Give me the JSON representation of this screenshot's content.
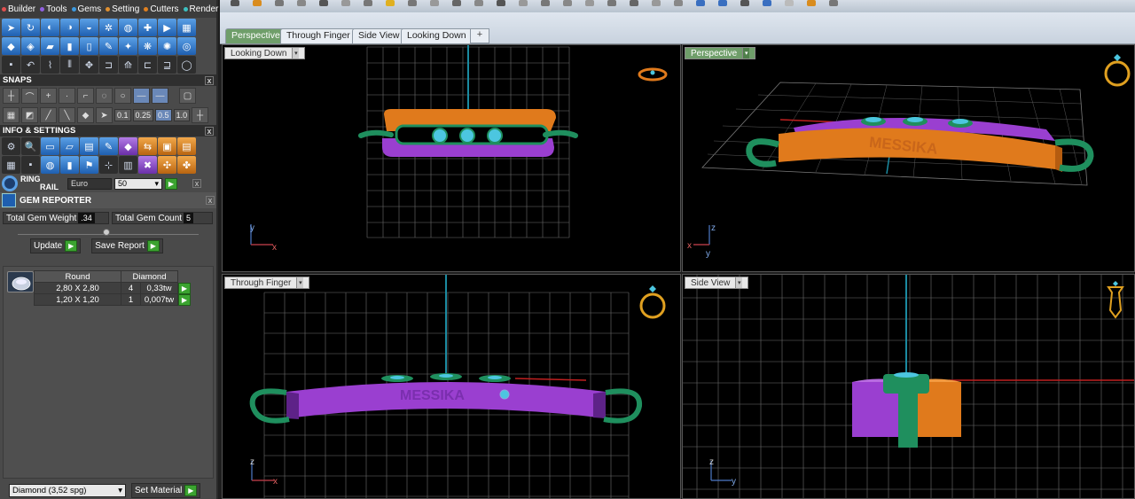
{
  "menu": [
    {
      "label": "Builder",
      "dot": "#e05050"
    },
    {
      "label": "Tools",
      "dot": "#9060e0"
    },
    {
      "label": "Gems",
      "dot": "#3c9ae0"
    },
    {
      "label": "Setting",
      "dot": "#e09030"
    },
    {
      "label": "Cutters",
      "dot": "#e08020"
    },
    {
      "label": "Render",
      "dot": "#3cc0c0"
    }
  ],
  "sections": {
    "snaps": "SNAPS",
    "info": "INFO & SETTINGS",
    "close": "x"
  },
  "snap_values": [
    "0.1",
    "0.25",
    "0.5",
    "1.0"
  ],
  "ring_rail": {
    "label_line1": "RING",
    "label_line2": "RAIL",
    "standard": "Euro",
    "size": "50",
    "go": "▶"
  },
  "gem_reporter": {
    "title": "GEM REPORTER",
    "total_weight_label": "Total Gem Weight",
    "total_weight_value": ".34",
    "total_count_label": "Total Gem Count",
    "total_count_value": "5",
    "update_label": "Update",
    "save_label": "Save Report",
    "table_headers": [
      "Round",
      "Diamond"
    ],
    "rows": [
      {
        "size": "2,80 X 2,80",
        "count": "4",
        "weight": "0,33tw"
      },
      {
        "size": "1,20 X 1,20",
        "count": "1",
        "weight": "0,007tw"
      }
    ]
  },
  "material": {
    "selected": "Diamond    (3,52 spg)",
    "set_label": "Set Material"
  },
  "tabs": [
    {
      "label": "Perspective",
      "active": true
    },
    {
      "label": "Through Finger",
      "active": false
    },
    {
      "label": "Side View",
      "active": false
    },
    {
      "label": "Looking Down",
      "active": false
    }
  ],
  "tab_add": "+",
  "viewports": {
    "top_left": "Looking Down",
    "top_right": "Perspective",
    "bottom_left": "Through Finger",
    "bottom_right": "Side View"
  },
  "engraving_text": "MESSIKA",
  "axes": {
    "y": "y",
    "x": "x",
    "z": "z"
  },
  "colors": {
    "orange": "#e07a1c",
    "purple": "#9a3fd0",
    "green": "#1f8f5e",
    "gem": "#4cc6e0",
    "grid": "#8a8a8a"
  }
}
